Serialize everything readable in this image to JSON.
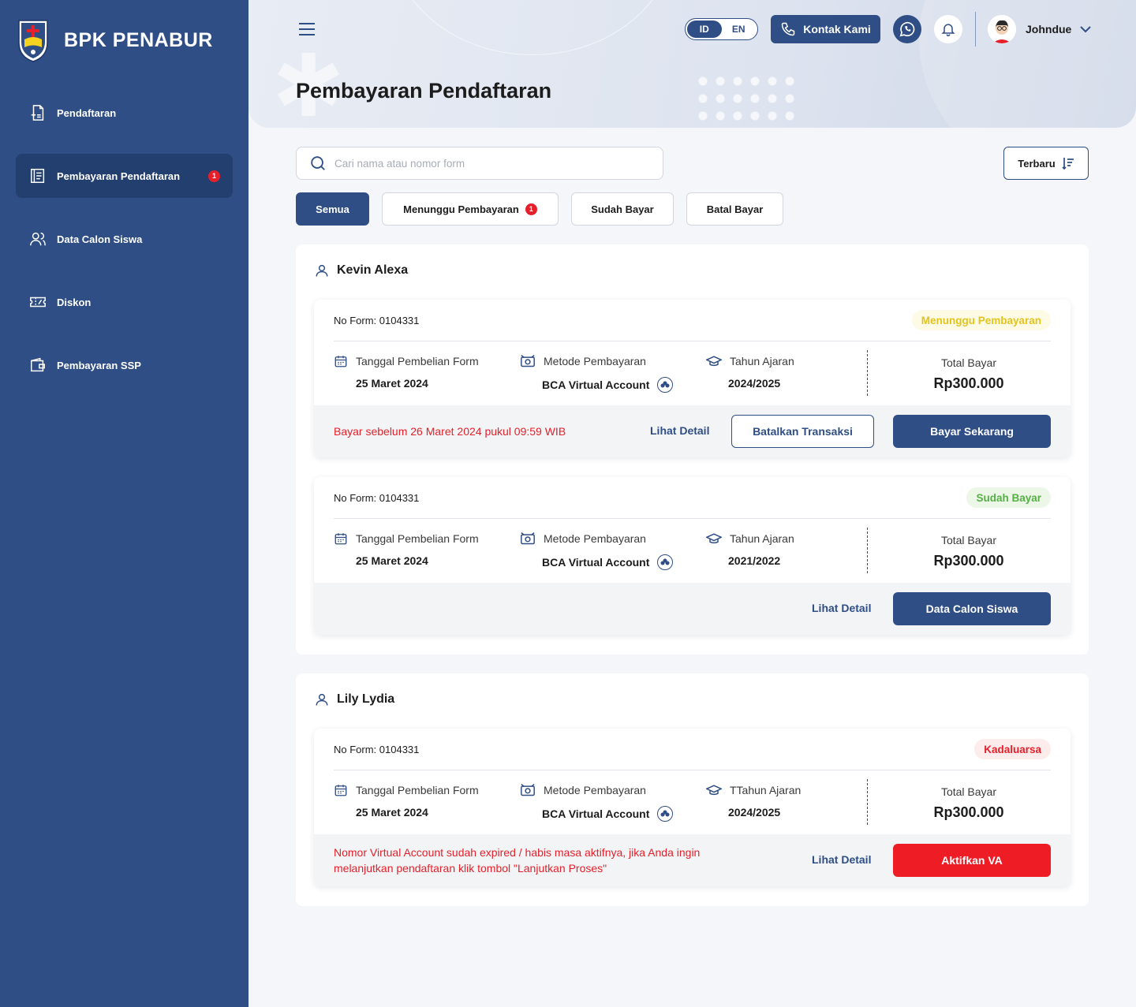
{
  "brand": {
    "name": "BPK PENABUR"
  },
  "sidebar": {
    "items": [
      {
        "label": "Pendaftaran",
        "icon": "file-plus-icon",
        "active": false
      },
      {
        "label": "Pembayaran Pendaftaran",
        "icon": "receipt-icon",
        "active": true,
        "badge": "1"
      },
      {
        "label": "Data Calon Siswa",
        "icon": "users-icon",
        "active": false
      },
      {
        "label": "Diskon",
        "icon": "ticket-icon",
        "active": false
      },
      {
        "label": "Pembayaran SSP",
        "icon": "wallet-icon",
        "active": false
      }
    ]
  },
  "header": {
    "lang": {
      "id": "ID",
      "en": "EN",
      "active": "ID"
    },
    "contact_label": "Kontak Kami",
    "user_name": "Johndue",
    "page_title": "Pembayaran Pendaftaran"
  },
  "search": {
    "placeholder": "Cari nama atau nomor form"
  },
  "sort": {
    "label": "Terbaru"
  },
  "filters": [
    {
      "label": "Semua",
      "active": true
    },
    {
      "label": "Menunggu Pembayaran",
      "badge": "1"
    },
    {
      "label": "Sudah Bayar"
    },
    {
      "label": "Batal Bayar"
    }
  ],
  "groups": [
    {
      "student": "Kevin Alexa",
      "cards": [
        {
          "form_no": "No Form: 0104331",
          "status": "Menunggu Pembayaran",
          "date_label": "Tanggal Pembelian Form",
          "date": "25 Maret 2024",
          "method_label": "Metode Pembayaran",
          "method": "BCA Virtual Account",
          "year_label": "Tahun Ajaran",
          "year": "2024/2025",
          "total_label": "Total Bayar",
          "total": "Rp300.000",
          "warning": "Bayar sebelum 26 Maret 2024 pukul 09:59 WIB",
          "detail_link": "Lihat Detail",
          "cancel_button": "Batalkan Transaksi",
          "action_button": "Bayar Sekarang"
        },
        {
          "form_no": "No Form: 0104331",
          "status": "Sudah Bayar",
          "date_label": "Tanggal Pembelian Form",
          "date": "25 Maret 2024",
          "method_label": "Metode Pembayaran",
          "method": "BCA Virtual Account",
          "year_label": "Tahun Ajaran",
          "year": "2021/2022",
          "total_label": "Total Bayar",
          "total": "Rp300.000",
          "detail_link": "Lihat Detail",
          "action_button": "Data Calon Siswa"
        }
      ]
    },
    {
      "student": "Lily Lydia",
      "cards": [
        {
          "form_no": "No Form: 0104331",
          "status": "Kadaluarsa",
          "date_label": "Tanggal Pembelian Form",
          "date": "25 Maret 2024",
          "method_label": "Metode Pembayaran",
          "method": "BCA Virtual Account",
          "year_label": "TTahun Ajaran",
          "year": "2024/2025",
          "total_label": "Total Bayar",
          "total": "Rp300.000",
          "warning_line1": "Nomor Virtual Account sudah expired / habis masa aktifnya, jika Anda ingin",
          "warning_line2": "melanjutkan pendaftaran klik tombol \"Lanjutkan Proses\"",
          "detail_link": "Lihat Detail",
          "action_button": "Aktifkan VA"
        }
      ]
    }
  ],
  "colors": {
    "primary": "#2f4e85",
    "danger": "#ee1c25",
    "pending": "#e5c31e",
    "paid": "#56b046"
  }
}
